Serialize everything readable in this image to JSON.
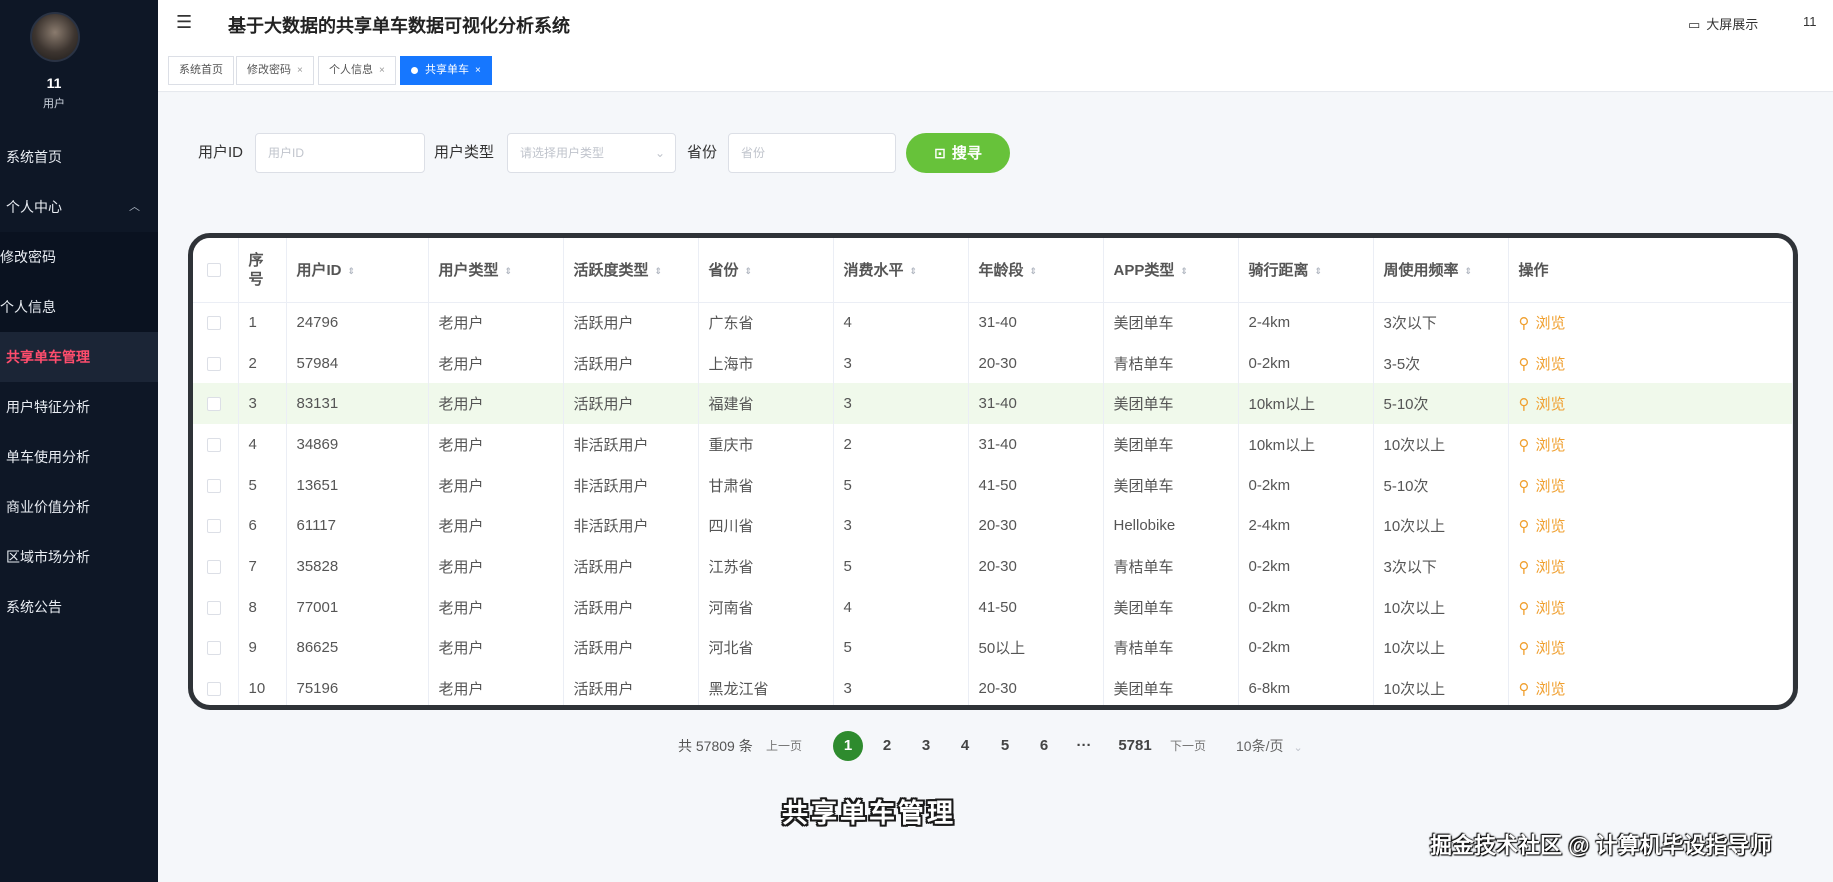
{
  "sidebar": {
    "user_name": "11",
    "user_role": "用户",
    "items": [
      {
        "label": "系统首页"
      },
      {
        "label": "个人中心"
      },
      {
        "label": "修改密码"
      },
      {
        "label": "个人信息"
      },
      {
        "label": "共享单车管理"
      },
      {
        "label": "用户特征分析"
      },
      {
        "label": "单车使用分析"
      },
      {
        "label": "商业价值分析"
      },
      {
        "label": "区域市场分析"
      },
      {
        "label": "系统公告"
      }
    ]
  },
  "header": {
    "title": "基于大数据的共享单车数据可视化分析系统",
    "bigscreen_label": "大屏展示",
    "user": "11",
    "tabs": [
      {
        "label": "系统首页"
      },
      {
        "label": "修改密码"
      },
      {
        "label": "个人信息"
      },
      {
        "label": "共享单车"
      }
    ]
  },
  "search": {
    "user_id_label": "用户ID",
    "user_id_placeholder": "用户ID",
    "user_type_label": "用户类型",
    "user_type_placeholder": "请选择用户类型",
    "province_label": "省份",
    "province_placeholder": "省份",
    "button_label": "搜寻"
  },
  "table": {
    "columns": [
      "序号",
      "用户ID",
      "用户类型",
      "活跃度类型",
      "省份",
      "消费水平",
      "年龄段",
      "APP类型",
      "骑行距离",
      "周使用频率",
      "操作"
    ],
    "view_label": "浏览",
    "rows": [
      [
        "1",
        "24796",
        "老用户",
        "活跃用户",
        "广东省",
        "4",
        "31-40",
        "美团单车",
        "2-4km",
        "3次以下"
      ],
      [
        "2",
        "57984",
        "老用户",
        "活跃用户",
        "上海市",
        "3",
        "20-30",
        "青桔单车",
        "0-2km",
        "3-5次"
      ],
      [
        "3",
        "83131",
        "老用户",
        "活跃用户",
        "福建省",
        "3",
        "31-40",
        "美团单车",
        "10km以上",
        "5-10次"
      ],
      [
        "4",
        "34869",
        "老用户",
        "非活跃用户",
        "重庆市",
        "2",
        "31-40",
        "美团单车",
        "10km以上",
        "10次以上"
      ],
      [
        "5",
        "13651",
        "老用户",
        "非活跃用户",
        "甘肃省",
        "5",
        "41-50",
        "美团单车",
        "0-2km",
        "5-10次"
      ],
      [
        "6",
        "61117",
        "老用户",
        "非活跃用户",
        "四川省",
        "3",
        "20-30",
        "Hellobike",
        "2-4km",
        "10次以上"
      ],
      [
        "7",
        "35828",
        "老用户",
        "活跃用户",
        "江苏省",
        "5",
        "20-30",
        "青桔单车",
        "0-2km",
        "3次以下"
      ],
      [
        "8",
        "77001",
        "老用户",
        "活跃用户",
        "河南省",
        "4",
        "41-50",
        "美团单车",
        "0-2km",
        "10次以上"
      ],
      [
        "9",
        "86625",
        "老用户",
        "活跃用户",
        "河北省",
        "5",
        "50以上",
        "青桔单车",
        "0-2km",
        "10次以上"
      ],
      [
        "10",
        "75196",
        "老用户",
        "活跃用户",
        "黑龙江省",
        "3",
        "20-30",
        "美团单车",
        "6-8km",
        "10次以上"
      ]
    ]
  },
  "pager": {
    "total": "共 57809 条",
    "prev": "上一页",
    "pages": [
      "1",
      "2",
      "3",
      "4",
      "5",
      "6"
    ],
    "ellipsis": "···",
    "last": "5781",
    "next": "下一页",
    "page_size": "10条/页"
  },
  "caption": "共享单车管理",
  "watermark": "掘金技术社区 @ 计算机毕设指导师"
}
